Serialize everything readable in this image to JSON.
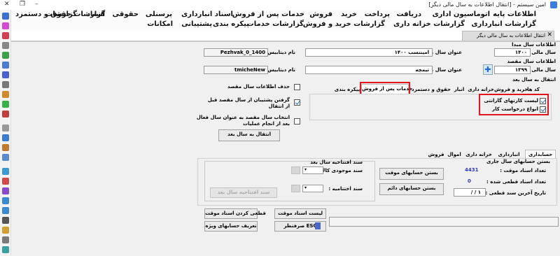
{
  "titlebar": {
    "title": "امین سیستم - [انتقال اطلاعات به سال مالی دیگر]",
    "minimize": "–",
    "restore": "❐",
    "close": "✕"
  },
  "menu": {
    "row1": [
      "اطلاعات پایه",
      "اتوماسیون اداری",
      "دریافت",
      "پرداخت",
      "خرید",
      "فروش",
      "خدمات پس از فروش",
      "اسناد انبارداری",
      "پرسنلی",
      "حقوقی",
      "اسناد",
      "گزارشات",
      "گزارشات حقوق و دستمزد"
    ],
    "row2": [
      "گزارشات انبارداری",
      "گزارشات خزانه داری",
      "گزارشات خرید و فروش",
      "گزارشات خدمات",
      "پیکره بندی",
      "پشتیبانی",
      "امکانات"
    ]
  },
  "doc_tab": {
    "label": "انتقال اطلاعات به سال مالی دیگر",
    "close": "✕"
  },
  "origin": {
    "section_title": "اطلاعات سال مبدا",
    "fiscal_year_label": "سال مالی :",
    "fiscal_year_value": "۱۴۰۰",
    "title_label": "عنوان سال مالی :",
    "title_value": "امیننسب ۱۴۰۰",
    "db_label": "نام دیتابیس :",
    "db_value": "Pezhvak_0_1400"
  },
  "dest": {
    "section_title": "اطلاعات سال مقصد",
    "fiscal_year_label": "سال مالی :",
    "fiscal_year_value": "۱۳۹۹",
    "title_label": "عنوان سال مالی :",
    "title_value": "تیمچه",
    "db_label": "نام دیتابیس :",
    "db_value": "tmicheNew"
  },
  "transfer": {
    "section_title": "انتقال به سال بعد",
    "tabs": [
      "کد ها",
      "خرید و فروش",
      "خزانه داری",
      "انبار",
      "حقوق و دستمزد",
      "خدمات پس از فروش",
      "پیکره بندی"
    ],
    "active_tab": "خدمات پس از فروش",
    "items": [
      "لیست کارتهای گارانتی",
      "انواع درخواست کار"
    ]
  },
  "options": {
    "delete_dest": "حذف اطلاعات سال مقصد",
    "backup": "گرفتن پشتیبان از سال مقصد قبل از انتقال",
    "select_dest_line1": "انتخاب سال مقصد به عنوان سال فعال",
    "select_dest_line2": "بعد از انجام عملیات",
    "transfer_button": "انتقال به سال بعد"
  },
  "accounting": {
    "tabs": [
      "حسابداری",
      "انبارداری",
      "خزانه داری",
      "اموال",
      "فروش"
    ],
    "active_tab": "حسابداری",
    "close_section": "بستن حسابهای سال جاری",
    "temp_count_label": "تعداد اسناد موقت :",
    "temp_count_value": "4431",
    "final_count_label": "تعداد اسناد قطعی شده :",
    "final_count_value": "0",
    "last_final_date_label": "تاریخ آخرین سند قطعی :",
    "last_final_date_value": "/ / ۱",
    "close_temp_button": "بستن حسابهای موقت",
    "close_perm_button": "بستن حسابهای دائم",
    "opening_section": "سند افتتاحیه سال بعد",
    "stock_label": "سند موجودی کالا :",
    "closing_label": "سند اختتامیه :",
    "opening_button": "سند افتتاحیه سال بعد"
  },
  "bottom": {
    "temp_list": "لیست اسناد موقت",
    "finalize": "قطعی کردن اسناد موقت",
    "exit": "صرفنظر ESC",
    "special_accounts": "تعریف حسابهای ویژه"
  },
  "colors": {
    "highlight_red": "#e3141b",
    "value_blue": "#2b39c8"
  }
}
